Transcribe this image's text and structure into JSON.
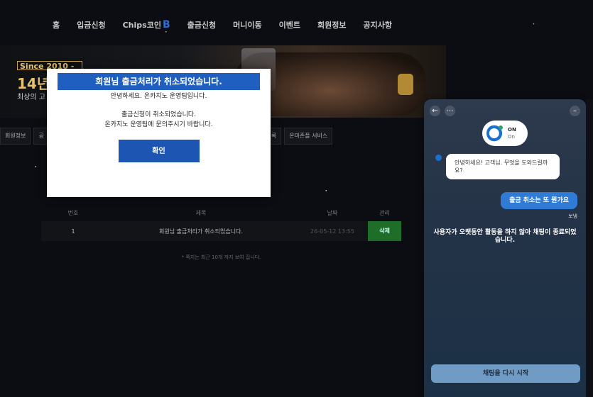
{
  "top_bar": {
    "text": ""
  },
  "nav": {
    "items": [
      {
        "label": "홈"
      },
      {
        "label": "입금신청"
      },
      {
        "label": "Chips코인",
        "badge": "B"
      },
      {
        "label": "출금신청"
      },
      {
        "label": "머니이동"
      },
      {
        "label": "이벤트"
      },
      {
        "label": "회원정보"
      },
      {
        "label": "공지사항"
      }
    ]
  },
  "hero": {
    "since": "Since 2010 -",
    "years": "14년",
    "subtitle": "최상의 고"
  },
  "sub_tabs": [
    "회원정보",
    "공",
    "록",
    "온마존플 서비스"
  ],
  "table": {
    "headers": [
      "번호",
      "제목",
      "날짜",
      "관리"
    ],
    "rows": [
      {
        "no": "1",
        "title": "회원님 출금처리가 취소되었습니다.",
        "date": "26-05-12 13:55",
        "action": "삭제"
      }
    ],
    "note": "* 쪽지는 최근 10개 까지 보여 집니다."
  },
  "modal": {
    "title": "회원님 출금처리가 취소되었습니다.",
    "greeting": "안녕하세요. 온카지노 운영팀입니다.",
    "body_line1": "출금신청이 취소되었습니다.",
    "body_line2": "온카지노 운영팀에 문의주시기 바랍니다.",
    "confirm_label": "확인"
  },
  "chat": {
    "brand_name": "ON",
    "brand_status": "On",
    "bot_message": "안녕하세요! 고객님. 무엇을 도와드릴까요?",
    "user_message": "출금 취소는 또 뭔가요",
    "sent_status": "보냄",
    "system_message": "사용자가 오랫동안 활동을 하지 않아 채팅이 종료되었습니다.",
    "restart_label": "채팅을 다시 시작",
    "back_icon": "arrow-left-icon",
    "more_icon": "ellipsis-icon",
    "minimize_icon": "minimize-icon"
  }
}
